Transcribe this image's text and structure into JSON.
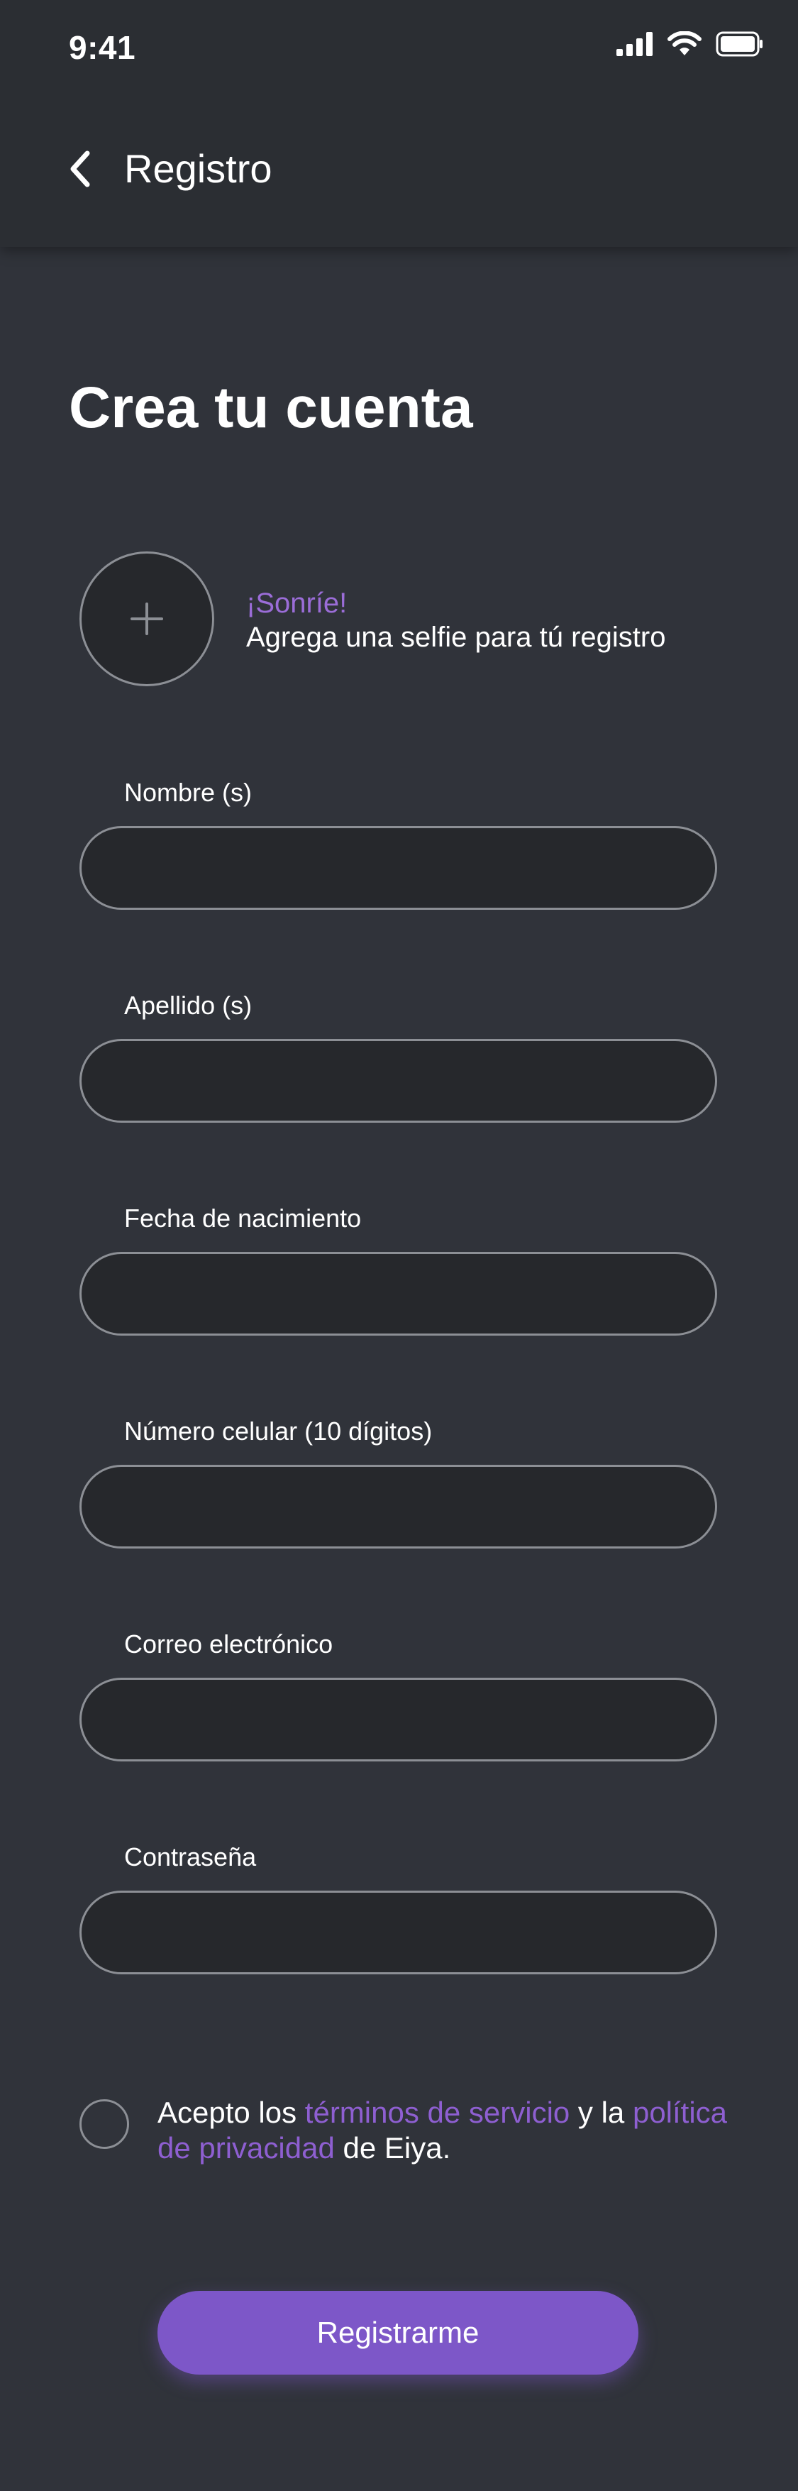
{
  "status_bar": {
    "time": "9:41",
    "icons": [
      "signal-icon",
      "wifi-icon",
      "battery-icon"
    ]
  },
  "header": {
    "back_icon": "chevron-left-icon",
    "title": "Registro"
  },
  "page": {
    "title": "Crea tu cuenta"
  },
  "selfie": {
    "icon": "plus-icon",
    "accent": "¡Sonríe!",
    "subtitle": "Agrega una selfie para tú registro"
  },
  "form": {
    "fields": [
      {
        "label": "Nombre (s)",
        "value": "",
        "placeholder": ""
      },
      {
        "label": "Apellido (s)",
        "value": "",
        "placeholder": ""
      },
      {
        "label": "Fecha de nacimiento",
        "value": "",
        "placeholder": ""
      },
      {
        "label": "Número celular (10 dígitos)",
        "value": "",
        "placeholder": ""
      },
      {
        "label": "Correo electrónico",
        "value": "",
        "placeholder": ""
      },
      {
        "label": "Contraseña",
        "value": "",
        "placeholder": ""
      }
    ]
  },
  "terms": {
    "checked": false,
    "prefix": "Acepto los ",
    "link1": "términos de servicio",
    "middle": " y la ",
    "link2": "política de privacidad",
    "suffix": " de Eiya."
  },
  "submit": {
    "label": "Registrarme"
  },
  "colors": {
    "background": "#30333a",
    "header": "#2b2e33",
    "input_bg": "#26282c",
    "border": "#8c8f95",
    "accent": "#7d57c8",
    "accent_text": "#9b6dd8"
  }
}
